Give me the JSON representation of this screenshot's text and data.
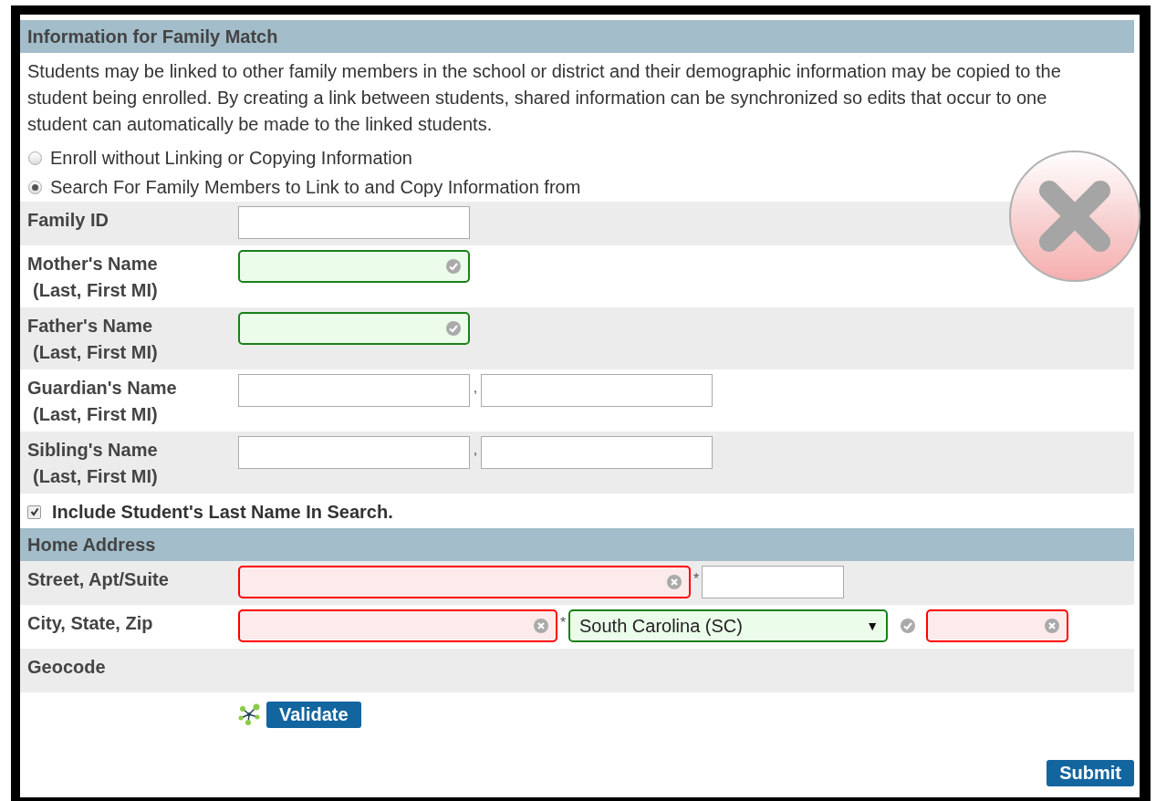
{
  "sections": [
    {
      "title": "Information for Family Match",
      "intro": "Students may be linked to other family members in the school or district and their demographic information may be copied to the student being enrolled. By creating a link between students, shared information can be synchronized so edits that occur to one student can automatically be made to the linked students.",
      "options": [
        {
          "label": "Enroll without Linking or Copying Information",
          "selected": false
        },
        {
          "label": "Search For Family Members to Link to and Copy Information from",
          "selected": true
        }
      ],
      "rows": [
        {
          "label": "Family ID",
          "fields": [
            {
              "kind": "field",
              "valid": false,
              "error": false
            }
          ]
        },
        {
          "label": "Mother's Name",
          "sublabel": "(Last, First MI)",
          "fields": [
            {
              "kind": "field",
              "valid": true,
              "error": false
            }
          ]
        },
        {
          "label": "Father's Name",
          "sublabel": "(Last, First MI)",
          "fields": [
            {
              "kind": "field",
              "valid": true,
              "error": false
            }
          ]
        },
        {
          "label": "Guardian's Name",
          "sublabel": "(Last, First MI)",
          "fields": [
            {
              "kind": "field",
              "valid": false,
              "error": false
            },
            {
              "kind": "separator",
              "text": ","
            },
            {
              "kind": "field",
              "valid": false,
              "error": false
            }
          ]
        },
        {
          "label": "Sibling's Name",
          "sublabel": "(Last, First MI)",
          "fields": [
            {
              "kind": "field",
              "valid": false,
              "error": false
            },
            {
              "kind": "separator",
              "text": ","
            },
            {
              "kind": "field",
              "valid": false,
              "error": false
            }
          ]
        }
      ],
      "checkbox": {
        "label": "Include Student's Last Name In Search.",
        "checked": true
      }
    },
    {
      "title": "Home Address",
      "rows": [
        {
          "label": "Street, Apt/Suite",
          "fields": [
            {
              "kind": "longfield",
              "valid": false,
              "error": true
            },
            {
              "kind": "separator",
              "text": "*"
            },
            {
              "kind": "shortfield",
              "valid": false,
              "error": false
            }
          ]
        },
        {
          "label": "City, State, Zip",
          "fields": [
            {
              "kind": "widefield",
              "valid": false,
              "error": true
            },
            {
              "kind": "separator",
              "text": "*"
            },
            {
              "kind": "select",
              "valid": true,
              "error": false,
              "value": "South Carolina (SC)",
              "arrow": "▼"
            },
            {
              "kind": "status",
              "valid": true,
              "error": false
            },
            {
              "kind": "shortfield",
              "valid": false,
              "error": true
            }
          ]
        },
        {
          "label": "Geocode",
          "fields": []
        }
      ],
      "action_button": "Validate"
    }
  ],
  "submit_button": "Submit"
}
